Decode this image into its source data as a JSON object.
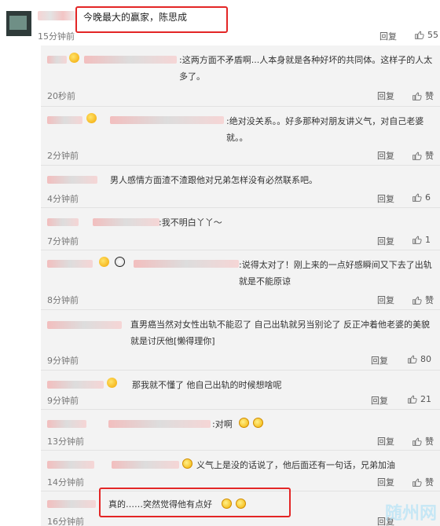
{
  "top": {
    "text": "今晚最大的赢家，陈思成",
    "time": "15分钟前",
    "reply": "回复",
    "likes": "55"
  },
  "replies": [
    {
      "text": ":这两方面不矛盾啊...人本身就是各种好坏的共同体。这样子的人太多了。",
      "time": "20秒前",
      "reply": "回复",
      "likes": "赞"
    },
    {
      "text": ":绝对没关系。。好多那种对朋友讲义气，对自己老婆就。。",
      "time": "2分钟前",
      "reply": "回复",
      "likes": "赞"
    },
    {
      "text": "男人感情方面渣不渣跟他对兄弟怎样没有必然联系吧。",
      "time": "4分钟前",
      "reply": "回复",
      "likes": "6"
    },
    {
      "text": ":我不明白丫丫～",
      "time": "7分钟前",
      "reply": "回复",
      "likes": "1"
    },
    {
      "text": ":说得太对了！刚上来的一点好感瞬间又下去了出轨就是不能原谅",
      "time": "8分钟前",
      "reply": "回复",
      "likes": "赞"
    },
    {
      "text": "直男癌当然对女性出轨不能忍了 自己出轨就另当别论了 反正冲着他老婆的美貌就是讨厌他[懒得理你]",
      "time": "9分钟前",
      "reply": "回复",
      "likes": "80"
    },
    {
      "text": "那我就不懂了 他自己出轨的时候想啥呢",
      "time": "9分钟前",
      "reply": "回复",
      "likes": "21"
    },
    {
      "text": ":对啊",
      "time": "13分钟前",
      "reply": "回复",
      "likes": "赞"
    },
    {
      "text": "义气上是没的话说了，他后面还有一句话，兄弟加油",
      "time": "14分钟前",
      "reply": "回复",
      "likes": "赞"
    },
    {
      "text": "真的……突然觉得他有点好",
      "time": "16分钟前",
      "reply": "回复",
      "likes": ""
    }
  ],
  "icons": {
    "like": "thumb-up-icon",
    "emoji": "emoji-icon",
    "panda": "panda-emoji-icon",
    "cry": "laugh-cry-emoji-icon"
  },
  "watermark": "随州网"
}
